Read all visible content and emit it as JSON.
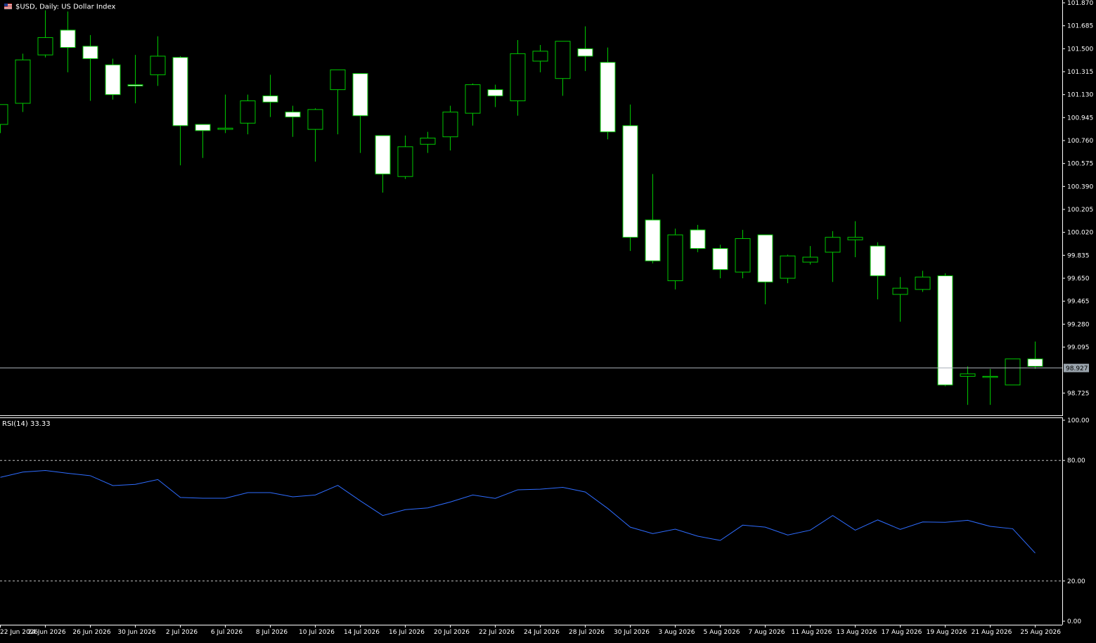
{
  "header": {
    "symbol": "$USD",
    "timeframe": "Daily:",
    "description": "US Dollar Index"
  },
  "colors": {
    "background": "#000000",
    "bull_body": "#000000",
    "bear_body": "#ffffff",
    "wick": "#00c800",
    "axis": "#ffffff",
    "text": "#ffffff",
    "rsi_line": "#2e6cff",
    "price_line": "#aab0b8",
    "price_label_bg": "#9aa4ad",
    "level_line": "#c0c0c0"
  },
  "chart_data": [
    {
      "type": "candlestick",
      "title": "$USD, Daily:  US Dollar Index",
      "y_ticks": [
        "101.870",
        "101.685",
        "101.500",
        "101.315",
        "101.130",
        "100.945",
        "100.760",
        "100.575",
        "100.390",
        "100.205",
        "100.020",
        "99.835",
        "99.650",
        "99.465",
        "99.280",
        "99.095",
        "98.725"
      ],
      "ylim": [
        98.571,
        101.87
      ],
      "current_price_label": "98.927",
      "current_price": 98.927,
      "x_tick_labels": [
        "22 Jun 2026",
        "24 Jun 2026",
        "26 Jun 2026",
        "30 Jun 2026",
        "2 Jul 2026",
        "6 Jul 2026",
        "8 Jul 2026",
        "10 Jul 2026",
        "14 Jul 2026",
        "16 Jul 2026",
        "20 Jul 2026",
        "22 Jul 2026",
        "24 Jul 2026",
        "28 Jul 2026",
        "30 Jul 2026",
        "3 Aug 2026",
        "5 Aug 2026",
        "7 Aug 2026",
        "11 Aug 2026",
        "13 Aug 2026",
        "17 Aug 2026",
        "19 Aug 2026",
        "21 Aug 2026",
        "25 Aug 2026"
      ],
      "candles": [
        {
          "o": 100.89,
          "h": 101.05,
          "l": 100.82,
          "c": 101.05
        },
        {
          "o": 101.06,
          "h": 101.46,
          "l": 100.99,
          "c": 101.41
        },
        {
          "o": 101.45,
          "h": 101.81,
          "l": 101.43,
          "c": 101.59
        },
        {
          "o": 101.65,
          "h": 101.8,
          "l": 101.31,
          "c": 101.51
        },
        {
          "o": 101.52,
          "h": 101.61,
          "l": 101.08,
          "c": 101.42
        },
        {
          "o": 101.37,
          "h": 101.42,
          "l": 101.09,
          "c": 101.13
        },
        {
          "o": 101.21,
          "h": 101.45,
          "l": 101.06,
          "c": 101.2
        },
        {
          "o": 101.29,
          "h": 101.6,
          "l": 101.2,
          "c": 101.44
        },
        {
          "o": 101.43,
          "h": 101.44,
          "l": 100.56,
          "c": 100.88
        },
        {
          "o": 100.89,
          "h": 100.89,
          "l": 100.62,
          "c": 100.84
        },
        {
          "o": 100.85,
          "h": 101.13,
          "l": 100.82,
          "c": 100.86
        },
        {
          "o": 100.9,
          "h": 101.13,
          "l": 100.81,
          "c": 101.08
        },
        {
          "o": 101.12,
          "h": 101.29,
          "l": 100.95,
          "c": 101.07
        },
        {
          "o": 100.99,
          "h": 101.04,
          "l": 100.79,
          "c": 100.95
        },
        {
          "o": 100.85,
          "h": 101.02,
          "l": 100.59,
          "c": 101.01
        },
        {
          "o": 101.17,
          "h": 101.32,
          "l": 100.81,
          "c": 101.33
        },
        {
          "o": 101.3,
          "h": 101.3,
          "l": 100.66,
          "c": 100.96
        },
        {
          "o": 100.8,
          "h": 100.8,
          "l": 100.34,
          "c": 100.49
        },
        {
          "o": 100.47,
          "h": 100.8,
          "l": 100.45,
          "c": 100.71
        },
        {
          "o": 100.73,
          "h": 100.83,
          "l": 100.66,
          "c": 100.78
        },
        {
          "o": 100.79,
          "h": 101.04,
          "l": 100.68,
          "c": 100.99
        },
        {
          "o": 100.98,
          "h": 101.22,
          "l": 100.88,
          "c": 101.21
        },
        {
          "o": 101.17,
          "h": 101.21,
          "l": 101.03,
          "c": 101.12
        },
        {
          "o": 101.08,
          "h": 101.57,
          "l": 100.96,
          "c": 101.46
        },
        {
          "o": 101.4,
          "h": 101.53,
          "l": 101.31,
          "c": 101.48
        },
        {
          "o": 101.26,
          "h": 101.56,
          "l": 101.12,
          "c": 101.56
        },
        {
          "o": 101.5,
          "h": 101.68,
          "l": 101.32,
          "c": 101.44
        },
        {
          "o": 101.39,
          "h": 101.51,
          "l": 100.77,
          "c": 100.83
        },
        {
          "o": 100.88,
          "h": 101.05,
          "l": 99.87,
          "c": 99.98
        },
        {
          "o": 100.12,
          "h": 100.49,
          "l": 99.77,
          "c": 99.79
        },
        {
          "o": 99.63,
          "h": 100.05,
          "l": 99.56,
          "c": 100.0
        },
        {
          "o": 100.04,
          "h": 100.08,
          "l": 99.86,
          "c": 99.89
        },
        {
          "o": 99.89,
          "h": 99.92,
          "l": 99.65,
          "c": 99.72
        },
        {
          "o": 99.7,
          "h": 100.04,
          "l": 99.65,
          "c": 99.97
        },
        {
          "o": 100.0,
          "h": 100.0,
          "l": 99.44,
          "c": 99.62
        },
        {
          "o": 99.65,
          "h": 99.84,
          "l": 99.61,
          "c": 99.83
        },
        {
          "o": 99.78,
          "h": 99.91,
          "l": 99.76,
          "c": 99.82
        },
        {
          "o": 99.86,
          "h": 100.03,
          "l": 99.62,
          "c": 99.98
        },
        {
          "o": 99.96,
          "h": 100.11,
          "l": 99.82,
          "c": 99.98
        },
        {
          "o": 99.91,
          "h": 99.94,
          "l": 99.48,
          "c": 99.67
        },
        {
          "o": 99.52,
          "h": 99.66,
          "l": 99.3,
          "c": 99.57
        },
        {
          "o": 99.56,
          "h": 99.71,
          "l": 99.54,
          "c": 99.66
        },
        {
          "o": 99.67,
          "h": 99.69,
          "l": 98.78,
          "c": 98.79
        },
        {
          "o": 98.86,
          "h": 98.94,
          "l": 98.63,
          "c": 98.88
        },
        {
          "o": 98.86,
          "h": 98.92,
          "l": 98.63,
          "c": 98.86
        },
        {
          "o": 98.79,
          "h": 99.0,
          "l": 98.79,
          "c": 99.0
        },
        {
          "o": 99.0,
          "h": 99.14,
          "l": 98.92,
          "c": 98.94
        }
      ]
    },
    {
      "type": "line",
      "title": "RSI(14) 33.33",
      "y_ticks": [
        "100.00",
        "80.00",
        "20.00",
        "0.00"
      ],
      "ylim": [
        0,
        100
      ],
      "levels": [
        80,
        20
      ],
      "series": [
        {
          "values": [
            71.6,
            74.2,
            75.0,
            73.6,
            72.4,
            67.5,
            68.1,
            70.5,
            61.6,
            61.2,
            61.2,
            64.0,
            64.0,
            61.9,
            62.8,
            67.6,
            59.9,
            52.6,
            55.5,
            56.4,
            59.3,
            62.8,
            61.1,
            65.4,
            65.7,
            66.6,
            64.3,
            56.1,
            46.8,
            43.6,
            45.8,
            42.3,
            40.2,
            47.8,
            46.8,
            42.9,
            45.3,
            52.6,
            45.3,
            50.4,
            45.7,
            49.4,
            49.2,
            50.2,
            47.2,
            46.0,
            33.9
          ]
        }
      ]
    }
  ]
}
